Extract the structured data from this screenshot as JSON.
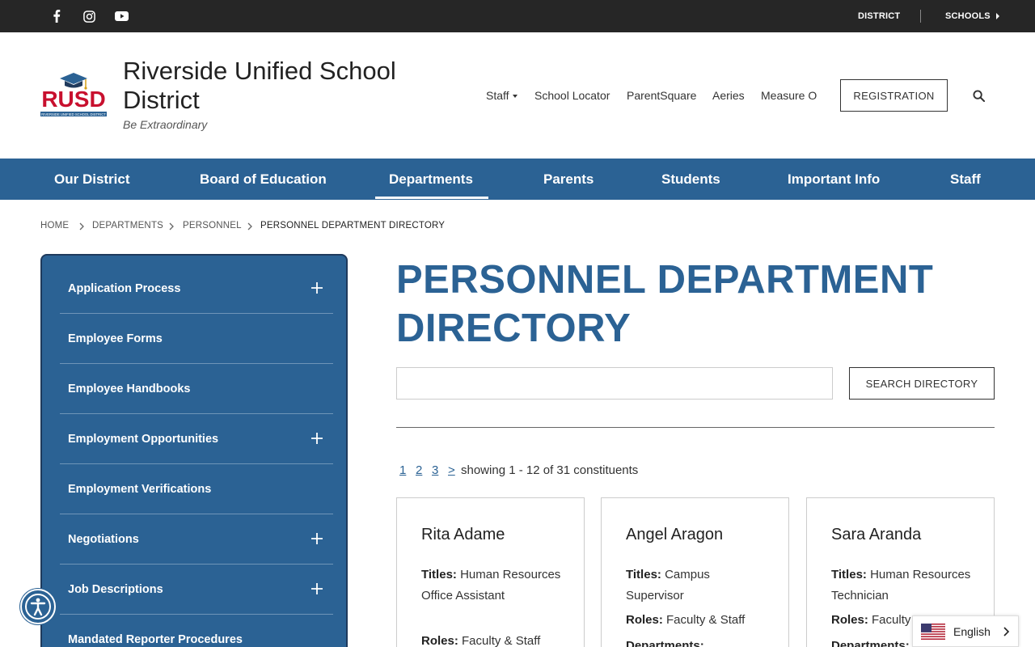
{
  "topbar": {
    "social_icons": [
      "facebook-icon",
      "instagram-icon",
      "youtube-icon"
    ],
    "links": {
      "district": "DISTRICT",
      "schools": "SCHOOLS"
    }
  },
  "header": {
    "logo_text": "RUSD",
    "logo_subtext": "RIVERSIDE UNIFIED SCHOOL DISTRICT",
    "title": "Riverside Unified School District",
    "tagline": "Be Extraordinary",
    "utility_links": [
      "Staff",
      "School Locator",
      "ParentSquare",
      "Aeries",
      "Measure O"
    ],
    "registration_label": "REGISTRATION",
    "search_icon": "search-icon"
  },
  "nav": {
    "items": [
      "Our District",
      "Board of Education",
      "Departments",
      "Parents",
      "Students",
      "Important Info",
      "Staff"
    ],
    "active": "Departments"
  },
  "breadcrumb": [
    "HOME",
    "DEPARTMENTS",
    "PERSONNEL",
    "PERSONNEL DEPARTMENT DIRECTORY"
  ],
  "sidebar": {
    "items": [
      {
        "label": "Application Process",
        "expandable": true
      },
      {
        "label": "Employee Forms",
        "expandable": false
      },
      {
        "label": "Employee Handbooks",
        "expandable": false
      },
      {
        "label": "Employment Opportunities",
        "expandable": true
      },
      {
        "label": "Employment Verifications",
        "expandable": false
      },
      {
        "label": "Negotiations",
        "expandable": true
      },
      {
        "label": "Job Descriptions",
        "expandable": true
      },
      {
        "label": "Mandated Reporter Procedures",
        "expandable": false
      }
    ]
  },
  "main": {
    "title": "PERSONNEL DEPARTMENT DIRECTORY",
    "search_value": "",
    "search_button": "SEARCH DIRECTORY",
    "pager": {
      "pages": [
        "1",
        "2",
        "3",
        ">"
      ],
      "summary": "showing 1 - 12 of 31 constituents"
    },
    "cards": [
      {
        "name": "Rita Adame",
        "titles_label": "Titles:",
        "titles": "Human Resources Office Assistant",
        "roles_label": "Roles:",
        "roles": "Faculty & Staff"
      },
      {
        "name": "Angel Aragon",
        "titles_label": "Titles:",
        "titles": "Campus Supervisor",
        "roles_label": "Roles:",
        "roles": "Faculty & Staff",
        "departments_label": "Departments:"
      },
      {
        "name": "Sara Aranda",
        "titles_label": "Titles:",
        "titles": "Human Resources Technician",
        "roles_label": "Roles:",
        "roles": "Faculty",
        "departments_label": "Departments:"
      }
    ]
  },
  "language": {
    "label": "English",
    "flag_icon": "us-flag-icon"
  },
  "colors": {
    "brand_blue": "#2b6294",
    "topbar": "#262626",
    "logo_red": "#c8102e"
  }
}
